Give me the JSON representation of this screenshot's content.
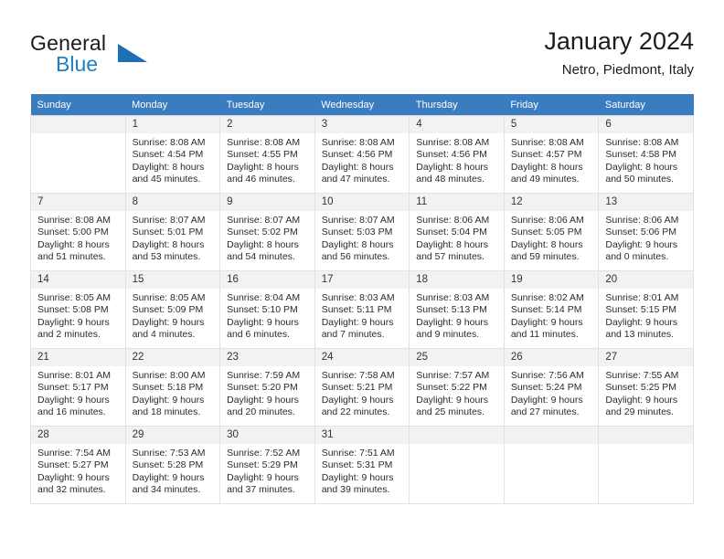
{
  "brand": {
    "name_part1": "General",
    "name_part2": "Blue",
    "triangle_color": "#1f6fb5",
    "blue_color": "#1f7fc4"
  },
  "header": {
    "title": "January 2024",
    "subtitle": "Netro, Piedmont, Italy"
  },
  "theme": {
    "header_row_bg": "#3a7cc0",
    "daynum_bg": "#f2f2f2",
    "cell_border": "#e2e2e2"
  },
  "weekday_headers": [
    "Sunday",
    "Monday",
    "Tuesday",
    "Wednesday",
    "Thursday",
    "Friday",
    "Saturday"
  ],
  "weeks": [
    [
      {
        "day": "",
        "empty": true,
        "sunrise": "",
        "sunset": "",
        "daylight_line1": "",
        "daylight_line2": ""
      },
      {
        "day": "1",
        "sunrise": "Sunrise: 8:08 AM",
        "sunset": "Sunset: 4:54 PM",
        "daylight_line1": "Daylight: 8 hours",
        "daylight_line2": "and 45 minutes."
      },
      {
        "day": "2",
        "sunrise": "Sunrise: 8:08 AM",
        "sunset": "Sunset: 4:55 PM",
        "daylight_line1": "Daylight: 8 hours",
        "daylight_line2": "and 46 minutes."
      },
      {
        "day": "3",
        "sunrise": "Sunrise: 8:08 AM",
        "sunset": "Sunset: 4:56 PM",
        "daylight_line1": "Daylight: 8 hours",
        "daylight_line2": "and 47 minutes."
      },
      {
        "day": "4",
        "sunrise": "Sunrise: 8:08 AM",
        "sunset": "Sunset: 4:56 PM",
        "daylight_line1": "Daylight: 8 hours",
        "daylight_line2": "and 48 minutes."
      },
      {
        "day": "5",
        "sunrise": "Sunrise: 8:08 AM",
        "sunset": "Sunset: 4:57 PM",
        "daylight_line1": "Daylight: 8 hours",
        "daylight_line2": "and 49 minutes."
      },
      {
        "day": "6",
        "sunrise": "Sunrise: 8:08 AM",
        "sunset": "Sunset: 4:58 PM",
        "daylight_line1": "Daylight: 8 hours",
        "daylight_line2": "and 50 minutes."
      }
    ],
    [
      {
        "day": "7",
        "sunrise": "Sunrise: 8:08 AM",
        "sunset": "Sunset: 5:00 PM",
        "daylight_line1": "Daylight: 8 hours",
        "daylight_line2": "and 51 minutes."
      },
      {
        "day": "8",
        "sunrise": "Sunrise: 8:07 AM",
        "sunset": "Sunset: 5:01 PM",
        "daylight_line1": "Daylight: 8 hours",
        "daylight_line2": "and 53 minutes."
      },
      {
        "day": "9",
        "sunrise": "Sunrise: 8:07 AM",
        "sunset": "Sunset: 5:02 PM",
        "daylight_line1": "Daylight: 8 hours",
        "daylight_line2": "and 54 minutes."
      },
      {
        "day": "10",
        "sunrise": "Sunrise: 8:07 AM",
        "sunset": "Sunset: 5:03 PM",
        "daylight_line1": "Daylight: 8 hours",
        "daylight_line2": "and 56 minutes."
      },
      {
        "day": "11",
        "sunrise": "Sunrise: 8:06 AM",
        "sunset": "Sunset: 5:04 PM",
        "daylight_line1": "Daylight: 8 hours",
        "daylight_line2": "and 57 minutes."
      },
      {
        "day": "12",
        "sunrise": "Sunrise: 8:06 AM",
        "sunset": "Sunset: 5:05 PM",
        "daylight_line1": "Daylight: 8 hours",
        "daylight_line2": "and 59 minutes."
      },
      {
        "day": "13",
        "sunrise": "Sunrise: 8:06 AM",
        "sunset": "Sunset: 5:06 PM",
        "daylight_line1": "Daylight: 9 hours",
        "daylight_line2": "and 0 minutes."
      }
    ],
    [
      {
        "day": "14",
        "sunrise": "Sunrise: 8:05 AM",
        "sunset": "Sunset: 5:08 PM",
        "daylight_line1": "Daylight: 9 hours",
        "daylight_line2": "and 2 minutes."
      },
      {
        "day": "15",
        "sunrise": "Sunrise: 8:05 AM",
        "sunset": "Sunset: 5:09 PM",
        "daylight_line1": "Daylight: 9 hours",
        "daylight_line2": "and 4 minutes."
      },
      {
        "day": "16",
        "sunrise": "Sunrise: 8:04 AM",
        "sunset": "Sunset: 5:10 PM",
        "daylight_line1": "Daylight: 9 hours",
        "daylight_line2": "and 6 minutes."
      },
      {
        "day": "17",
        "sunrise": "Sunrise: 8:03 AM",
        "sunset": "Sunset: 5:11 PM",
        "daylight_line1": "Daylight: 9 hours",
        "daylight_line2": "and 7 minutes."
      },
      {
        "day": "18",
        "sunrise": "Sunrise: 8:03 AM",
        "sunset": "Sunset: 5:13 PM",
        "daylight_line1": "Daylight: 9 hours",
        "daylight_line2": "and 9 minutes."
      },
      {
        "day": "19",
        "sunrise": "Sunrise: 8:02 AM",
        "sunset": "Sunset: 5:14 PM",
        "daylight_line1": "Daylight: 9 hours",
        "daylight_line2": "and 11 minutes."
      },
      {
        "day": "20",
        "sunrise": "Sunrise: 8:01 AM",
        "sunset": "Sunset: 5:15 PM",
        "daylight_line1": "Daylight: 9 hours",
        "daylight_line2": "and 13 minutes."
      }
    ],
    [
      {
        "day": "21",
        "sunrise": "Sunrise: 8:01 AM",
        "sunset": "Sunset: 5:17 PM",
        "daylight_line1": "Daylight: 9 hours",
        "daylight_line2": "and 16 minutes."
      },
      {
        "day": "22",
        "sunrise": "Sunrise: 8:00 AM",
        "sunset": "Sunset: 5:18 PM",
        "daylight_line1": "Daylight: 9 hours",
        "daylight_line2": "and 18 minutes."
      },
      {
        "day": "23",
        "sunrise": "Sunrise: 7:59 AM",
        "sunset": "Sunset: 5:20 PM",
        "daylight_line1": "Daylight: 9 hours",
        "daylight_line2": "and 20 minutes."
      },
      {
        "day": "24",
        "sunrise": "Sunrise: 7:58 AM",
        "sunset": "Sunset: 5:21 PM",
        "daylight_line1": "Daylight: 9 hours",
        "daylight_line2": "and 22 minutes."
      },
      {
        "day": "25",
        "sunrise": "Sunrise: 7:57 AM",
        "sunset": "Sunset: 5:22 PM",
        "daylight_line1": "Daylight: 9 hours",
        "daylight_line2": "and 25 minutes."
      },
      {
        "day": "26",
        "sunrise": "Sunrise: 7:56 AM",
        "sunset": "Sunset: 5:24 PM",
        "daylight_line1": "Daylight: 9 hours",
        "daylight_line2": "and 27 minutes."
      },
      {
        "day": "27",
        "sunrise": "Sunrise: 7:55 AM",
        "sunset": "Sunset: 5:25 PM",
        "daylight_line1": "Daylight: 9 hours",
        "daylight_line2": "and 29 minutes."
      }
    ],
    [
      {
        "day": "28",
        "sunrise": "Sunrise: 7:54 AM",
        "sunset": "Sunset: 5:27 PM",
        "daylight_line1": "Daylight: 9 hours",
        "daylight_line2": "and 32 minutes."
      },
      {
        "day": "29",
        "sunrise": "Sunrise: 7:53 AM",
        "sunset": "Sunset: 5:28 PM",
        "daylight_line1": "Daylight: 9 hours",
        "daylight_line2": "and 34 minutes."
      },
      {
        "day": "30",
        "sunrise": "Sunrise: 7:52 AM",
        "sunset": "Sunset: 5:29 PM",
        "daylight_line1": "Daylight: 9 hours",
        "daylight_line2": "and 37 minutes."
      },
      {
        "day": "31",
        "sunrise": "Sunrise: 7:51 AM",
        "sunset": "Sunset: 5:31 PM",
        "daylight_line1": "Daylight: 9 hours",
        "daylight_line2": "and 39 minutes."
      },
      {
        "day": "",
        "empty": true,
        "sunrise": "",
        "sunset": "",
        "daylight_line1": "",
        "daylight_line2": ""
      },
      {
        "day": "",
        "empty": true,
        "sunrise": "",
        "sunset": "",
        "daylight_line1": "",
        "daylight_line2": ""
      },
      {
        "day": "",
        "empty": true,
        "sunrise": "",
        "sunset": "",
        "daylight_line1": "",
        "daylight_line2": ""
      }
    ]
  ]
}
